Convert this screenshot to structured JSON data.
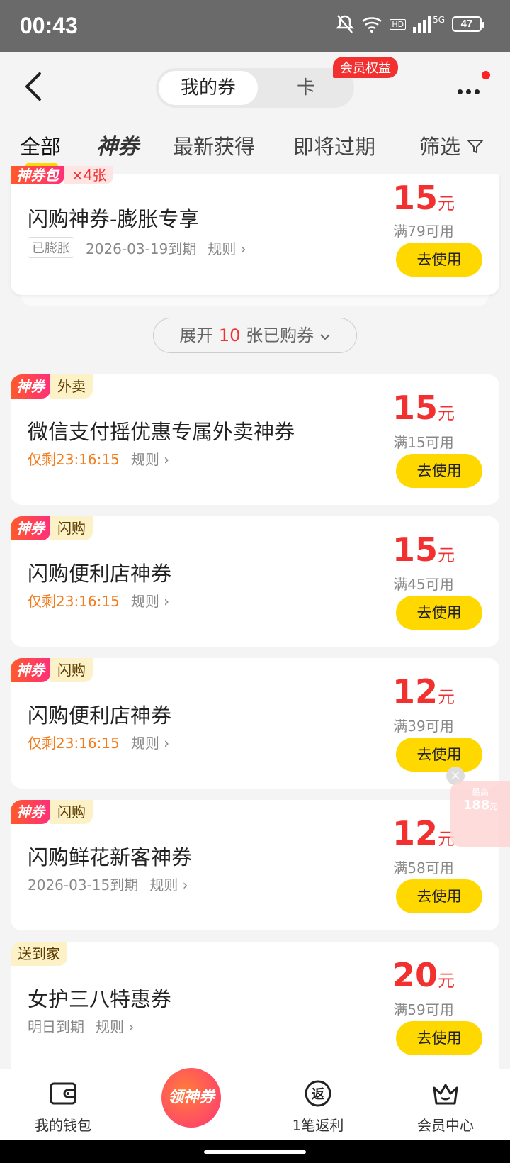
{
  "status_bar": {
    "time": "00:43",
    "network": "5G",
    "battery": "47"
  },
  "header": {
    "seg_active": "我的券",
    "seg_inactive": "卡",
    "vip_badge": "会员权益"
  },
  "tabs": [
    {
      "label": "全部"
    },
    {
      "label": "神券"
    },
    {
      "label": "最新获得"
    },
    {
      "label": "即将过期"
    },
    {
      "label": "筛选"
    }
  ],
  "top_card": {
    "tag": "神券包",
    "tag_count": "×4张",
    "title": "闪购神券-膨胀专享",
    "chip": "已膨胀",
    "expire": "2026-03-19到期",
    "rule": "规则",
    "amount": "15",
    "unit": "元",
    "condition": "满79可用",
    "button": "去使用"
  },
  "expand": {
    "prefix": "展开",
    "count": "10",
    "suffix": "张已购券"
  },
  "coupons": [
    {
      "tag": "神券",
      "category": "外卖",
      "title": "微信支付摇优惠专属外卖神券",
      "time": "仅剩23:16:15",
      "rule": "规则",
      "amount": "15",
      "unit": "元",
      "condition": "满15可用",
      "button": "去使用"
    },
    {
      "tag": "神券",
      "category": "闪购",
      "title": "闪购便利店神券",
      "time": "仅剩23:16:15",
      "rule": "规则",
      "amount": "15",
      "unit": "元",
      "condition": "满45可用",
      "button": "去使用"
    },
    {
      "tag": "神券",
      "category": "闪购",
      "title": "闪购便利店神券",
      "time": "仅剩23:16:15",
      "rule": "规则",
      "amount": "12",
      "unit": "元",
      "condition": "满39可用",
      "button": "去使用"
    },
    {
      "tag": "神券",
      "category": "闪购",
      "title": "闪购鲜花新客神券",
      "time": "2026-03-15到期",
      "rule": "规则",
      "amount": "12",
      "unit": "元",
      "condition": "满58可用",
      "button": "去使用"
    },
    {
      "tag": "",
      "category": "送到家",
      "title": "女护三八特惠券",
      "time": "明日到期",
      "rule": "规则",
      "amount": "20",
      "unit": "元",
      "condition": "满59可用",
      "button": "去使用"
    }
  ],
  "float_badge": {
    "label": "最高",
    "amount": "188",
    "unit": "元"
  },
  "bottom_nav": [
    {
      "label": "我的钱包"
    },
    {
      "label": "领神券"
    },
    {
      "label": "1笔返利"
    },
    {
      "label": "会员中心"
    }
  ],
  "colors": {
    "accent_yellow": "#ffd800",
    "price_red": "#f23030",
    "countdown_orange": "#f27b1b"
  }
}
